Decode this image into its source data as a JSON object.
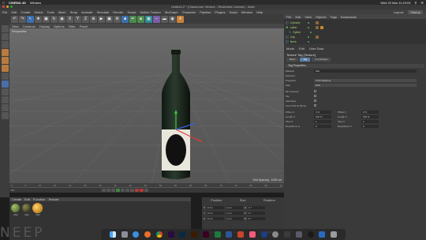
{
  "macbar": {
    "app": "CINEMA 4D",
    "menu": "Window",
    "clock": "Wed 22 Mar 11:19:03"
  },
  "window": {
    "title": "Untitled 2 * (Classroom Version - Restricted License) - Main"
  },
  "menubar": {
    "items": [
      "File",
      "Edit",
      "Create",
      "Select",
      "Tools",
      "Mesh",
      "Snap",
      "Animate",
      "Simulate",
      "Render",
      "Sculpt",
      "Motion Tracker",
      "MoGraph",
      "Character",
      "Pipeline",
      "Plugins",
      "Script",
      "Window",
      "Help"
    ],
    "layout_label": "Layout:",
    "layout_value": "Startup"
  },
  "viewport": {
    "menu": [
      "View",
      "Cameras",
      "Display",
      "Options",
      "Filter",
      "Panel"
    ],
    "label": "Perspective",
    "grid_spacing": "Grid Spacing : 1000 cm"
  },
  "timeline": {
    "ticks": [
      "0",
      "5",
      "10",
      "15",
      "20",
      "25",
      "30",
      "35",
      "40",
      "45",
      "50",
      "55",
      "60",
      "65",
      "70",
      "75",
      "80",
      "85",
      "90"
    ],
    "frame": "0 F"
  },
  "materials": {
    "menu": [
      "Create",
      "Edit",
      "Function",
      "Texture"
    ],
    "items": [
      "Mat",
      "Mat",
      "Mat"
    ],
    "colors": [
      "#6b7f3a",
      "#4a4a2a",
      "#d99a28"
    ]
  },
  "coords": {
    "headers": [
      "Position",
      "Size",
      "Rotation"
    ],
    "rows": [
      {
        "axis": "X",
        "pos": "0 cm",
        "size": "1 cm",
        "rot": "0 °",
        "rl": "H"
      },
      {
        "axis": "Y",
        "pos": "0 cm",
        "size": "1 cm",
        "rot": "0 °",
        "rl": "P"
      },
      {
        "axis": "Z",
        "pos": "0 cm",
        "size": "1 cm",
        "rot": "0 °",
        "rl": "B"
      }
    ],
    "mode": "Object (Rel)",
    "size_mode": "Size",
    "apply": "Apply"
  },
  "objects": {
    "menu": [
      "File",
      "Edit",
      "View",
      "Objects",
      "Tags",
      "Bookmarks"
    ],
    "items": [
      "Cylinder",
      "Lathe",
      "Spline",
      "Cap",
      "Neck"
    ]
  },
  "attributes": {
    "menu": [
      "Mode",
      "Edit",
      "User Data"
    ],
    "title": "Texture Tag [Texture]",
    "tabs": [
      "Basic",
      "Tag",
      "Coordinates"
    ],
    "section": "Tag Properties",
    "props": [
      {
        "label": "Material",
        "value": "Mat"
      },
      {
        "label": "Selection",
        "value": ""
      },
      {
        "label": "Projection",
        "value": "UVW Mapping"
      },
      {
        "label": "Side",
        "value": "Both"
      }
    ],
    "checks": [
      "Mix Textures",
      "Tile",
      "Seamless",
      "Use UVW for Bump"
    ],
    "offsets": [
      {
        "l": "Offset U",
        "v": "0 %",
        "l2": "Offset V",
        "v2": "0 %"
      },
      {
        "l": "Length U",
        "v": "100 %",
        "l2": "Length V",
        "v2": "100 %"
      },
      {
        "l": "Tiles U",
        "v": "1",
        "l2": "Tiles V",
        "v2": "1"
      },
      {
        "l": "Repetitions U",
        "v": "0",
        "l2": "Repetitions V",
        "v2": "0"
      }
    ]
  },
  "ghost_text": "NEEP"
}
